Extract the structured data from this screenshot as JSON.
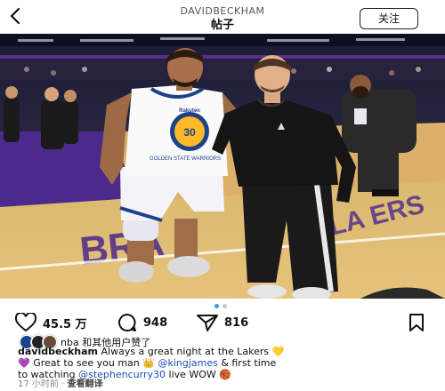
{
  "header": {
    "username": "DAVIDBECKHAM",
    "title": "帖子",
    "follow_label": "关注"
  },
  "carousel": {
    "count": 2,
    "active_index": 0
  },
  "photo": {
    "jersey_text": "GOLDEN STATE WARRIORS",
    "jersey_number": "30",
    "court_text": "LA  ERS",
    "court_text_2": "BRA",
    "jersey_brand": "Rakuten"
  },
  "actions": {
    "likes": "45.5 万",
    "comments": "948",
    "shares": "816"
  },
  "liked_by": {
    "text": "nba 和其他用户赞了"
  },
  "caption": {
    "username": "davidbeckham",
    "line1_text": "Always a great night at the Lakers 💛",
    "line2_pre": "💜  Great to see you man 👑 ",
    "mention1": "@kingjames",
    "line2_post": " & first time",
    "line3_pre": "to watching ",
    "mention2": "@stephencurry30",
    "line3_post": " live WOW 🏀"
  },
  "meta": {
    "time": "17 小时前",
    "separator": "·",
    "translate": "查看翻译"
  }
}
